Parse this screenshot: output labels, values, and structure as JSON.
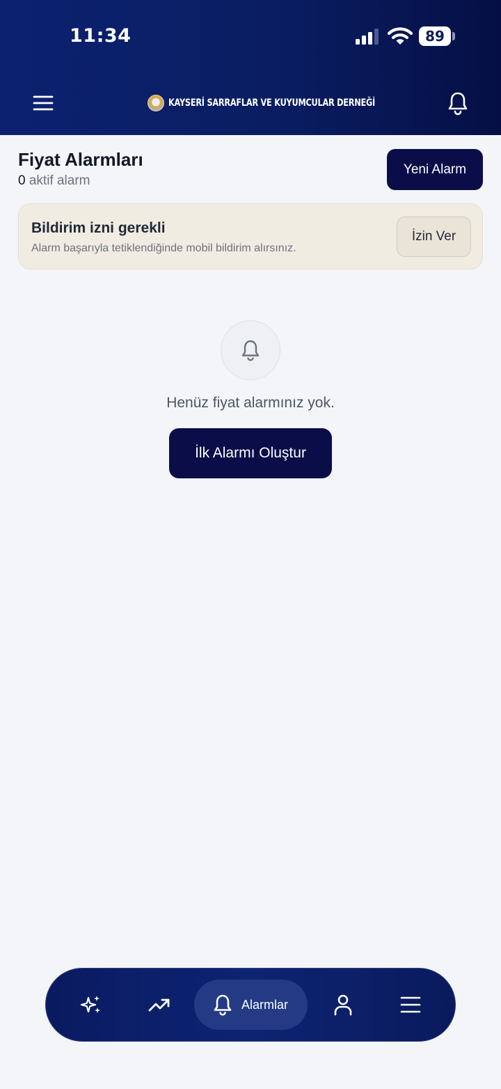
{
  "status_bar": {
    "time": "11:34",
    "battery": "89"
  },
  "header": {
    "brand_name": "KAYSERİ SARRAFLAR VE KUYUMCULAR DERNEĞİ",
    "icons": [
      "menu-icon",
      "bell-icon"
    ]
  },
  "page": {
    "title": "Fiyat Alarmları",
    "active_count": "0",
    "active_label": "aktif alarm",
    "new_alarm_label": "Yeni Alarm"
  },
  "permission_card": {
    "title": "Bildirim izni gerekli",
    "description": "Alarm başarıyla tetiklendiğinde mobil bildirim alırsınız.",
    "button_label": "İzin Ver"
  },
  "empty_state": {
    "icon": "bell-icon",
    "message": "Henüz fiyat alarmınız yok.",
    "button_label": "İlk Alarmı Oluştur"
  },
  "bottom_nav": {
    "items": [
      {
        "icon": "sparkles-icon"
      },
      {
        "icon": "trending-up-icon"
      },
      {
        "icon": "bell-icon",
        "label": "Alarmlar",
        "active": true
      },
      {
        "icon": "user-icon"
      },
      {
        "icon": "menu-icon"
      }
    ]
  },
  "colors": {
    "header_bg": "#0c2270",
    "primary_button": "#0b0d49",
    "page_bg": "#f3f5f8",
    "warning_card_bg": "#f1ece2"
  }
}
